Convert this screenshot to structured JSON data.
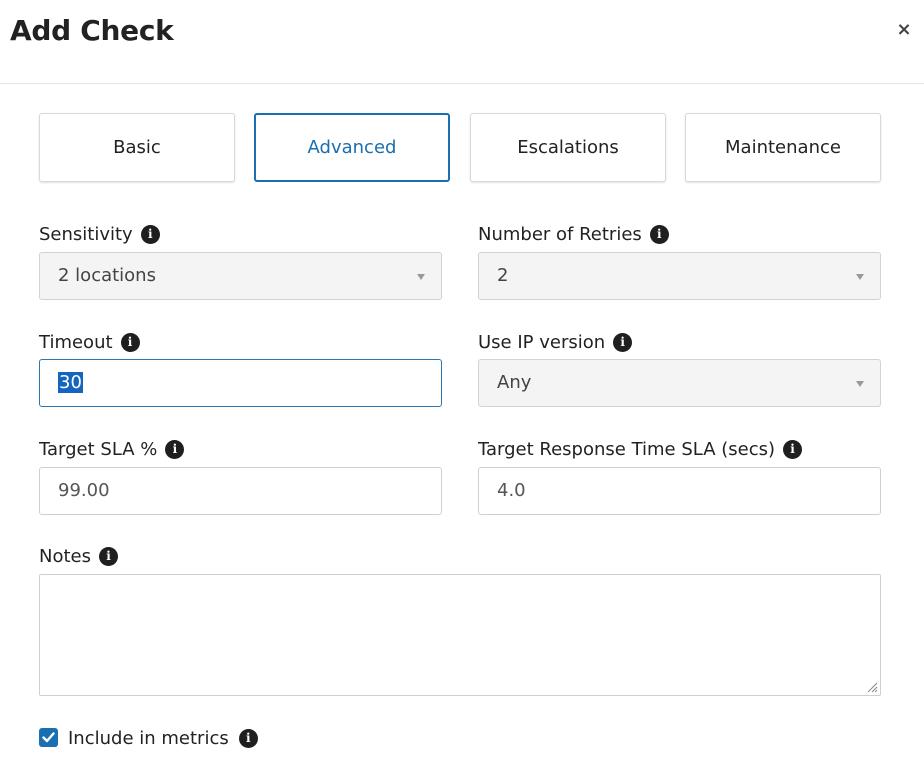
{
  "dialog": {
    "title": "Add Check",
    "close_glyph": "×"
  },
  "tabs": [
    {
      "label": "Basic",
      "active": false
    },
    {
      "label": "Advanced",
      "active": true
    },
    {
      "label": "Escalations",
      "active": false
    },
    {
      "label": "Maintenance",
      "active": false
    }
  ],
  "fields": {
    "sensitivity": {
      "label": "Sensitivity",
      "value": "2 locations"
    },
    "retries": {
      "label": "Number of Retries",
      "value": "2"
    },
    "timeout": {
      "label": "Timeout",
      "value": "30"
    },
    "ip_version": {
      "label": "Use IP version",
      "value": "Any"
    },
    "target_sla": {
      "label": "Target SLA %",
      "value": "99.00"
    },
    "target_response_sla": {
      "label": "Target Response Time SLA (secs)",
      "value": "4.0"
    },
    "notes": {
      "label": "Notes",
      "value": ""
    },
    "include_metrics": {
      "label": "Include in metrics",
      "checked": true
    }
  },
  "icons": {
    "info": "info-icon",
    "caret": "chevron-down-icon",
    "check": "check-icon",
    "close": "close-icon"
  },
  "colors": {
    "accent": "#1a6fb0",
    "selection": "#1565c0"
  },
  "info_glyph": "i"
}
